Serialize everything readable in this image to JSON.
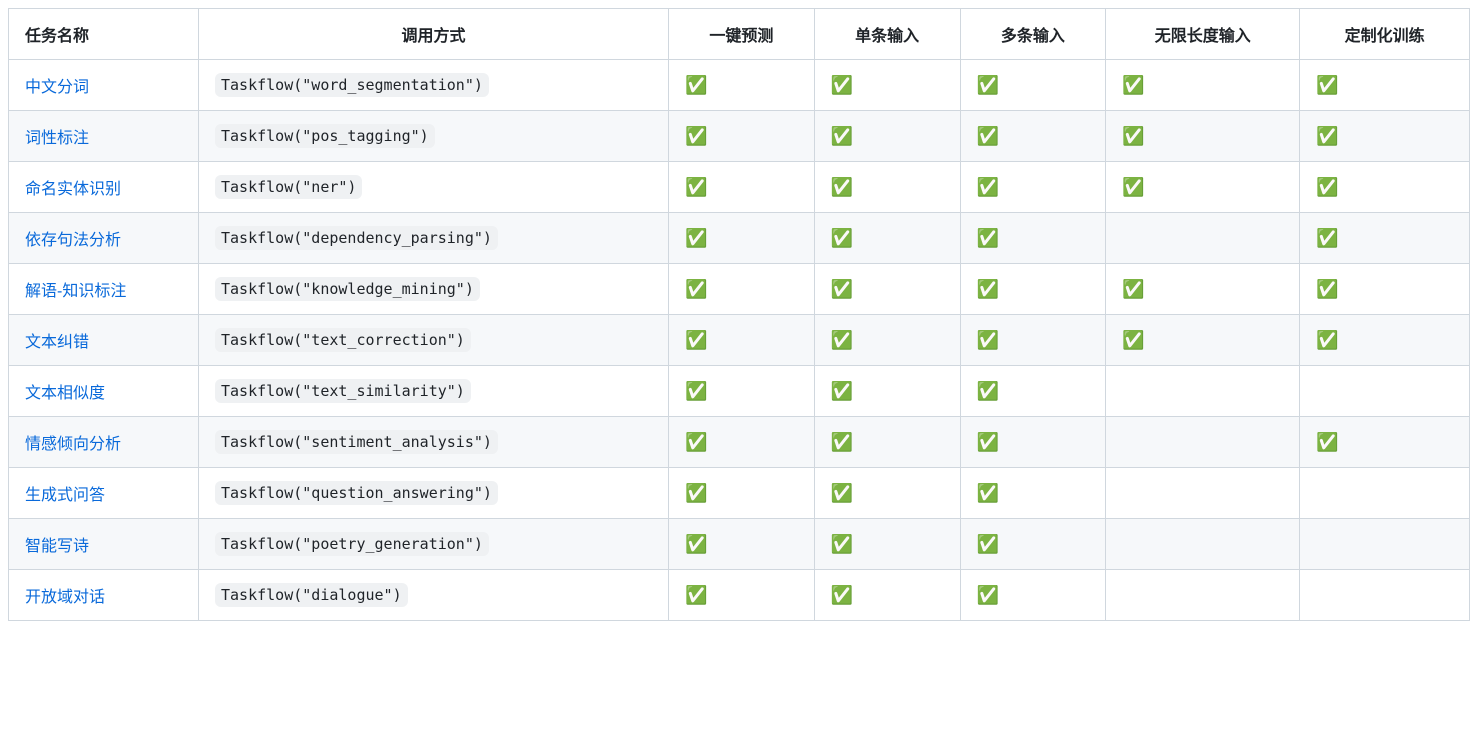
{
  "headers": [
    "任务名称",
    "调用方式",
    "一键预测",
    "单条输入",
    "多条输入",
    "无限长度输入",
    "定制化训练"
  ],
  "check_symbol": "✅",
  "rows": [
    {
      "task": "中文分词",
      "invocation": "Taskflow(\"word_segmentation\")",
      "checks": [
        true,
        true,
        true,
        true,
        true
      ]
    },
    {
      "task": "词性标注",
      "invocation": "Taskflow(\"pos_tagging\")",
      "checks": [
        true,
        true,
        true,
        true,
        true
      ]
    },
    {
      "task": "命名实体识别",
      "invocation": "Taskflow(\"ner\")",
      "checks": [
        true,
        true,
        true,
        true,
        true
      ]
    },
    {
      "task": "依存句法分析",
      "invocation": "Taskflow(\"dependency_parsing\")",
      "checks": [
        true,
        true,
        true,
        false,
        true
      ]
    },
    {
      "task": "解语-知识标注",
      "invocation": "Taskflow(\"knowledge_mining\")",
      "checks": [
        true,
        true,
        true,
        true,
        true
      ]
    },
    {
      "task": "文本纠错",
      "invocation": "Taskflow(\"text_correction\")",
      "checks": [
        true,
        true,
        true,
        true,
        true
      ]
    },
    {
      "task": "文本相似度",
      "invocation": "Taskflow(\"text_similarity\")",
      "checks": [
        true,
        true,
        true,
        false,
        false
      ]
    },
    {
      "task": "情感倾向分析",
      "invocation": "Taskflow(\"sentiment_analysis\")",
      "checks": [
        true,
        true,
        true,
        false,
        true
      ]
    },
    {
      "task": "生成式问答",
      "invocation": "Taskflow(\"question_answering\")",
      "checks": [
        true,
        true,
        true,
        false,
        false
      ]
    },
    {
      "task": "智能写诗",
      "invocation": "Taskflow(\"poetry_generation\")",
      "checks": [
        true,
        true,
        true,
        false,
        false
      ]
    },
    {
      "task": "开放域对话",
      "invocation": "Taskflow(\"dialogue\")",
      "checks": [
        true,
        true,
        true,
        false,
        false
      ]
    }
  ]
}
